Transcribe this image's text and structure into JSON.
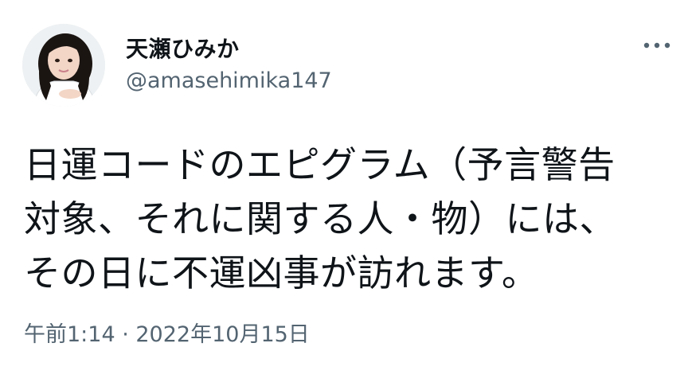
{
  "tweet": {
    "display_name": "天瀬ひみか",
    "handle": "@amasehimika147",
    "text": "日運コードのエピグラム（予言警告\n対象、それに関する人・物）には、\nその日に不運凶事が訪れます。",
    "timestamp": "午前1:14 · 2022年10月15日",
    "avatar_icon": "profile-photo",
    "more_icon": "more-horizontal-icon"
  },
  "colors": {
    "text_primary": "#0f1419",
    "text_secondary": "#536471",
    "background": "#ffffff"
  }
}
